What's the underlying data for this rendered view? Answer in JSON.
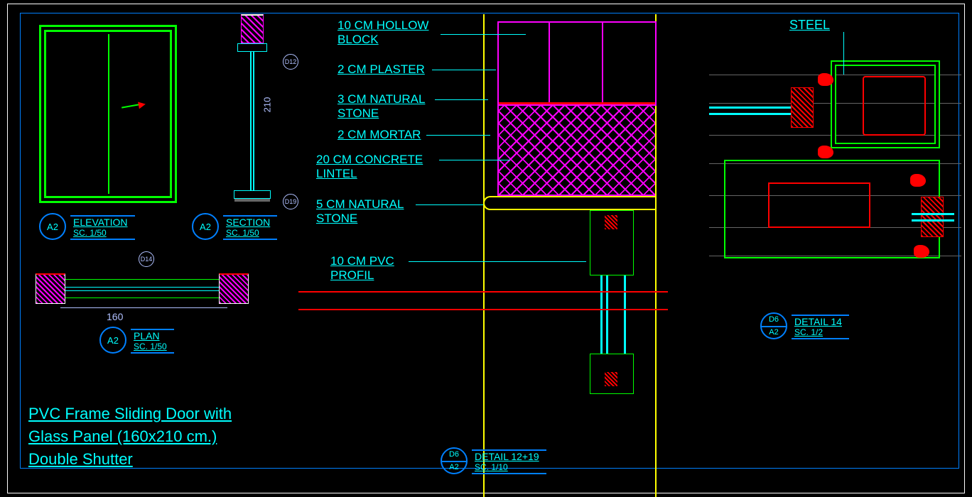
{
  "title": {
    "line1": "PVC Frame Sliding Door with",
    "line2": "Glass Panel (160x210 cm.)",
    "line3": "Double Shutter"
  },
  "views": {
    "elevation": {
      "name": "ELEVATION",
      "scale": "SC. 1/50",
      "sheet": "A2"
    },
    "section": {
      "name": "SECTION",
      "scale": "SC. 1/50",
      "sheet": "A2"
    },
    "plan": {
      "name": "PLAN",
      "scale": "SC. 1/50",
      "sheet": "A2"
    },
    "detail12": {
      "name": "DETAIL 12+19",
      "scale": "SC. 1/10",
      "ref": "D6",
      "sheet": "A2"
    },
    "detail14": {
      "name": "DETAIL 14",
      "scale": "SC. 1/2",
      "ref": "D6",
      "sheet": "A2"
    }
  },
  "dimensions": {
    "height": "210",
    "width": "160"
  },
  "callouts": {
    "d12": "D12",
    "d14": "D14",
    "d19": "D19"
  },
  "materials": {
    "hollow_block": "10 CM HOLLOW\nBLOCK",
    "plaster": "2 CM PLASTER",
    "nat_stone_3": "3 CM NATURAL\nSTONE",
    "mortar": "2 CM MORTAR",
    "lintel": "20 CM CONCRETE\nLINTEL",
    "nat_stone_5": "5 CM NATURAL\nSTONE",
    "pvc_profile": "10 CM PVC\nPROFIL",
    "steel": "STEEL"
  },
  "colors": {
    "cyan": "#00ffff",
    "green": "#00ff00",
    "magenta": "#ff00ff",
    "yellow": "#ffff00",
    "red": "#ff0000",
    "blue": "#0080ff"
  }
}
